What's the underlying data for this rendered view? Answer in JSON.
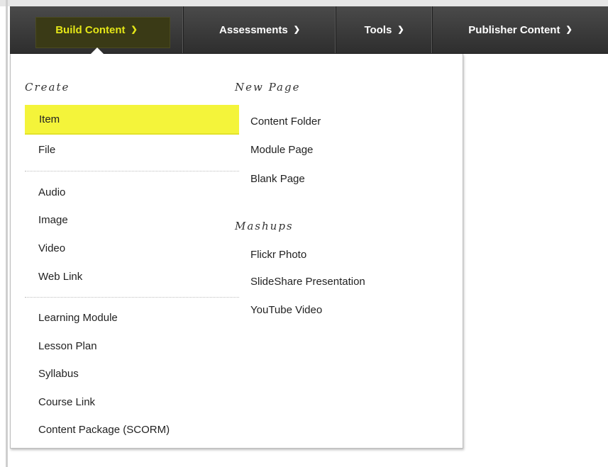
{
  "toolbar": {
    "build_content": {
      "label": "Build Content",
      "icon": "chevron-down-icon",
      "highlight_color": "#e4e617"
    },
    "assessments": {
      "label": "Assessments",
      "icon": "chevron-down-icon"
    },
    "tools": {
      "label": "Tools",
      "icon": "chevron-down-icon"
    },
    "publisher_content": {
      "label": "Publisher Content",
      "icon": "chevron-down-icon"
    }
  },
  "menu": {
    "create": {
      "heading": "Create",
      "items": [
        "Item",
        "File",
        "Audio",
        "Image",
        "Video",
        "Web Link",
        "Learning Module",
        "Lesson Plan",
        "Syllabus",
        "Course Link",
        "Content Package (SCORM)"
      ],
      "selected": "Item",
      "selected_color": "#f4f43a"
    },
    "new_page": {
      "heading": "New Page",
      "items": [
        "Content Folder",
        "Module Page",
        "Blank Page"
      ]
    },
    "mashups": {
      "heading": "Mashups",
      "items": [
        "Flickr Photo",
        "SlideShare Presentation",
        "YouTube Video"
      ]
    }
  }
}
